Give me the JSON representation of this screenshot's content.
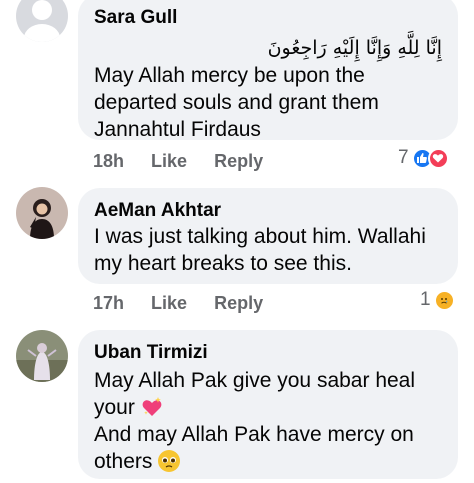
{
  "comments": [
    {
      "name": "Sara Gull",
      "arabic": "إِنَّا لِلَّهِ وَإِنَّا إِلَيْهِ رَاجِعُونَ",
      "lines": [
        "May Allah mercy be upon the",
        "departed souls and grant them",
        "Jannahtul Firdaus"
      ],
      "time": "18h",
      "like_label": "Like",
      "reply_label": "Reply",
      "reaction_count": "7",
      "reactions": [
        "like-icon",
        "love-icon"
      ]
    },
    {
      "name": "AeMan Akhtar",
      "lines": [
        "I was just talking about him. Wallahi",
        "my heart breaks to see this."
      ],
      "time": "17h",
      "like_label": "Like",
      "reply_label": "Reply",
      "reaction_count": "1",
      "reactions": [
        "sad-icon"
      ]
    },
    {
      "name": "Uban Tirmizi",
      "lines": [
        "May Allah Pak give you sabar heal",
        "your",
        "And may Allah Pak have mercy on",
        "others"
      ],
      "emojis": [
        "sparkling-heart-emoji",
        "pleading-face-emoji"
      ]
    }
  ],
  "colors": {
    "bubble": "#f0f2f5",
    "meta": "#65676b",
    "like": "#1877f2",
    "love": "#f33e58",
    "sad": "#f7b125"
  }
}
